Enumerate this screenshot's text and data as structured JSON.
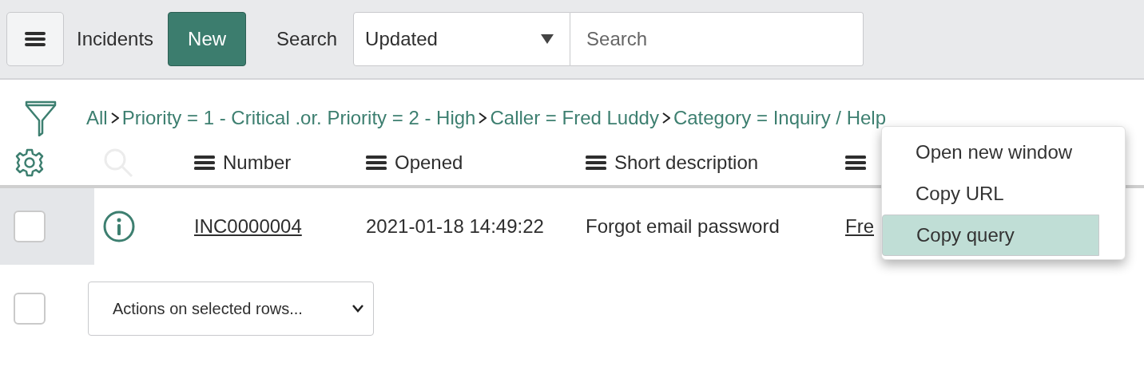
{
  "header": {
    "title": "Incidents",
    "new_button": "New",
    "search_label": "Search",
    "search_field_select": "Updated",
    "search": {
      "placeholder": "Search"
    }
  },
  "breadcrumb": {
    "all": "All",
    "items": [
      {
        "label": "Priority = 1 - Critical .or. Priority = 2 - High"
      },
      {
        "label": "Caller = Fred Luddy"
      },
      {
        "label": "Category = Inquiry / Help"
      }
    ]
  },
  "table": {
    "columns": [
      {
        "label": "Number"
      },
      {
        "label": "Opened"
      },
      {
        "label": "Short description"
      },
      {}
    ],
    "rows": [
      {
        "checked": false,
        "cells": [
          {
            "text": "INC0000004",
            "kind": "link"
          },
          {
            "text": "2021-01-18 14:49:22",
            "kind": "text"
          },
          {
            "text": "Forgot email password",
            "kind": "text"
          },
          {
            "text": "Fre",
            "kind": "link"
          }
        ]
      }
    ]
  },
  "footer": {
    "select_all_checked": false,
    "actions": "Actions on selected rows..."
  },
  "context_menu": {
    "items": [
      {
        "label": "Open new window",
        "selected": false
      },
      {
        "label": "Copy URL",
        "selected": false
      },
      {
        "label": "Copy query",
        "selected": true
      }
    ]
  }
}
